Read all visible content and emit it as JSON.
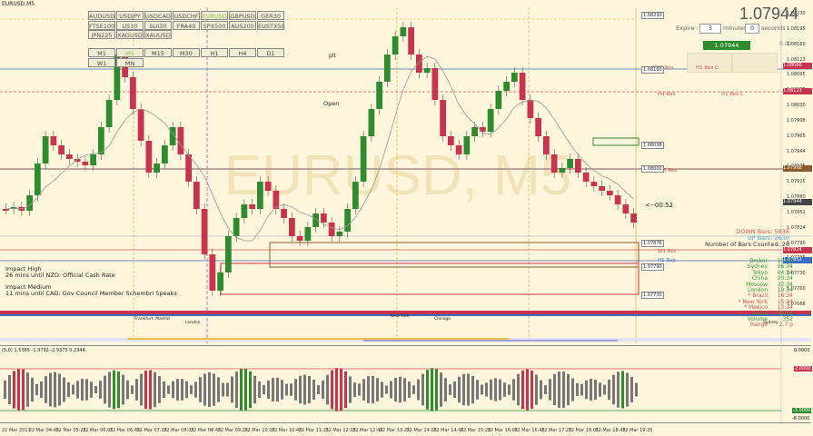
{
  "window": {
    "title": "EURUSD,M5",
    "watermark": "EURUSD, M5"
  },
  "price": {
    "big": "1.07944",
    "order_price": "1.07944",
    "pct": "0.00"
  },
  "expiry": {
    "label": "Expire :",
    "minutes_value": "5",
    "minutes_label": "minutes",
    "seconds_value": "0",
    "seconds_label": "seconds"
  },
  "symbols": [
    [
      "AUDUSD",
      "USDJPY",
      "USDCAD",
      "USDCHF",
      "EURUSD",
      "GBPUSD",
      "GER30"
    ],
    [
      "FTSE100",
      "US30",
      "SUI30",
      "FRA40",
      "SPX500",
      "AUS200",
      "EUSTX50"
    ],
    [
      "JPN225",
      "XAGUSD",
      "XAUUSD"
    ]
  ],
  "active_symbol": "EURUSD",
  "timeframes": [
    [
      "M1",
      "M5",
      "M15",
      "M30",
      "H1",
      "H4",
      "D1"
    ],
    [
      "W1",
      "MN"
    ]
  ],
  "labels": {
    "pit": "pit",
    "open": "Open",
    "countdown": "<--00:52",
    "down_bars": "DOWN Bars: 5938",
    "up_bars": "UP Bars: 2630",
    "bars_counted": "Number of Bars Counted: 20"
  },
  "levels": [
    {
      "text": "H1 Res C",
      "price": "1.08066",
      "color": "#d9534f"
    },
    {
      "text": "M30 Res",
      "price": "",
      "color": "#d9534f"
    },
    {
      "text": "H4 Res",
      "price": "1.08123",
      "color": "#d9534f"
    },
    {
      "text": "D1 Res C",
      "price": "",
      "color": "#d9534f"
    },
    {
      "text": "M15 Res",
      "price": "1.07998",
      "color": "#d9534f"
    },
    {
      "text": "H1 Sup",
      "price": "1.07852",
      "color": "#3b6cc4"
    },
    {
      "text": "W1 Res",
      "price": "1.07824",
      "color": "#d9534f"
    }
  ],
  "axis_prices": [
    "1.08230",
    "1.08195",
    "1.08160",
    "1.08123",
    "1.08095",
    "1.08065",
    "1.08030",
    "1.07998",
    "1.07965",
    "1.07944",
    "1.07935",
    "1.07915",
    "1.07880",
    "1.07852",
    "1.07824",
    "1.07790",
    "1.07765",
    "1.07730",
    "1.07700",
    "1.07668"
  ],
  "box_prices": [
    "1.08230",
    "1.08160",
    "1.08038",
    "1.08000",
    "1.07876",
    "1.07790",
    "1.07730"
  ],
  "news": [
    {
      "title": "Impact High",
      "detail": "26 mins until NZD: Official Cash Rate",
      "color": "#d9534f",
      "detail_color": "#3fa7d6"
    },
    {
      "title": "Impact Medium",
      "detail": "11 mins until CAD: Gov Council Member Schembri Speaks",
      "color": "#c13fd6",
      "detail_color": "#3fa7d6"
    }
  ],
  "sessions": [
    {
      "name": "Broker",
      "time": "19:34",
      "color": "#2e9e2e"
    },
    {
      "name": "Sydney",
      "time": "06:34",
      "color": "#2e9e2e"
    },
    {
      "name": "Tokyo",
      "time": "04:34",
      "color": "#2e9e2e"
    },
    {
      "name": "China",
      "time": "03:34",
      "color": "#2e9e2e"
    },
    {
      "name": "Moscow",
      "time": "22:34",
      "color": "#2e9e2e"
    },
    {
      "name": "London",
      "time": "19:34",
      "color": "#2e9e2e"
    },
    {
      "name": "* Brazil",
      "time": "16:34",
      "color": "#d9534f"
    },
    {
      "name": "* New York",
      "time": "15:34",
      "color": "#d9534f"
    },
    {
      "name": "* Mexico",
      "time": "13:34",
      "color": "#d9534f"
    },
    {
      "name": "Local",
      "time": "20:34",
      "color": "#2e9e2e"
    },
    {
      "name": "Volume",
      "time": "352",
      "color": "#2e9e2e"
    },
    {
      "name": "Range",
      "time": "2.7 p",
      "color": "#d9534f"
    }
  ],
  "session_bar_labels": {
    "frankfurt": "Frankfurt, Madrid",
    "london": "London",
    "newyork": "New York",
    "chicago": "Chicago",
    "sydney": "Sydney"
  },
  "indicator": {
    "header": "(5,0) 1.5365 -1.9792 -2.9375 0.2344",
    "top_level": "2.0000",
    "bottom_level": "-2.0000",
    "axis_top": "8.0000",
    "axis_bottom": "-8.0000"
  },
  "times": [
    "22 Mar 2017",
    "22 Mar 04:45",
    "22 Mar 05:25",
    "22 Mar 06:05",
    "22 Mar 06:45",
    "22 Mar 07:25",
    "22 Mar 08:05",
    "22 Mar 08:45",
    "22 Mar 09:25",
    "22 Mar 10:05",
    "22 Mar 10:45",
    "22 Mar 11:25",
    "22 Mar 12:05",
    "22 Mar 12:45",
    "22 Mar 13:25",
    "22 Mar 14:05",
    "22 Mar 14:45",
    "22 Mar 15:25",
    "22 Mar 16:05",
    "22 Mar 16:45",
    "22 Mar 17:25",
    "22 Mar 18:05",
    "22 Mar 18:45",
    "22 Mar 19:25"
  ],
  "colors": {
    "bull": "#2e8b2e",
    "bear": "#c8334d",
    "bg": "#fdf6dc"
  }
}
